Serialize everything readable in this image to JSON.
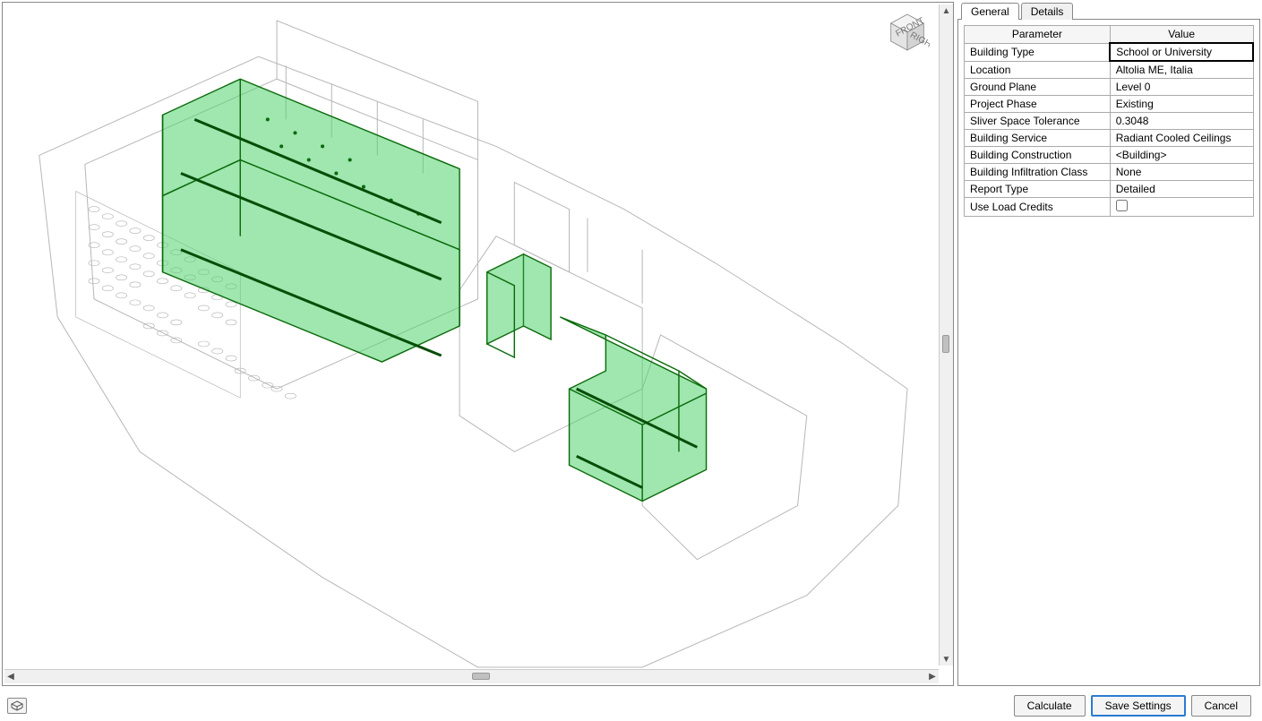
{
  "tabs": {
    "general": "General",
    "details": "Details",
    "active": "general"
  },
  "table": {
    "headers": {
      "param": "Parameter",
      "value": "Value"
    },
    "rows": [
      {
        "param": "Building Type",
        "value": "School or University",
        "selected": true
      },
      {
        "param": "Location",
        "value": "Altolia ME, Italia"
      },
      {
        "param": "Ground Plane",
        "value": "Level 0"
      },
      {
        "param": "Project Phase",
        "value": "Existing"
      },
      {
        "param": "Sliver Space Tolerance",
        "value": "0.3048"
      },
      {
        "param": "Building Service",
        "value": "Radiant Cooled Ceilings"
      },
      {
        "param": "Building Construction",
        "value": "<Building>"
      },
      {
        "param": "Building Infiltration Class",
        "value": "None"
      },
      {
        "param": "Report Type",
        "value": "Detailed"
      },
      {
        "param": "Use Load Credits",
        "value": "",
        "checkbox": true,
        "checked": false
      }
    ]
  },
  "buttons": {
    "calculate": "Calculate",
    "save": "Save Settings",
    "cancel": "Cancel"
  }
}
